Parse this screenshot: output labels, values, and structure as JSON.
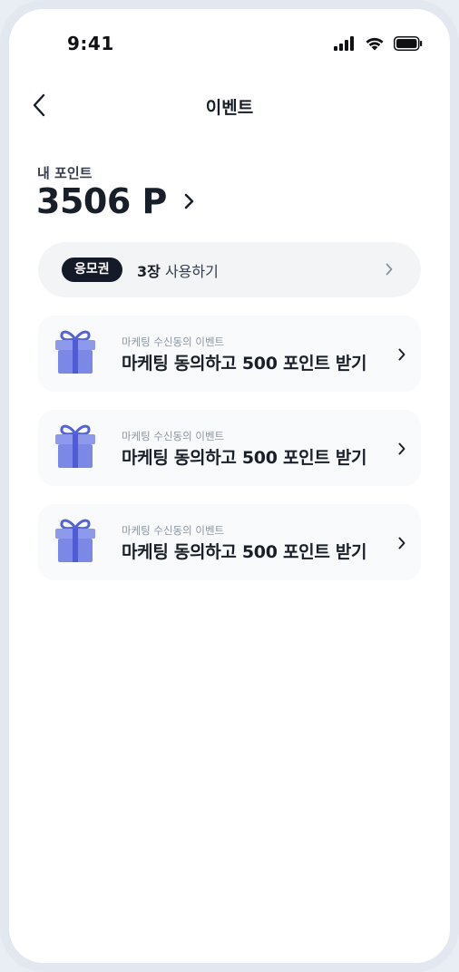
{
  "status_bar": {
    "time": "9:41",
    "icons": [
      "signal-icon",
      "wifi-icon",
      "battery-icon"
    ]
  },
  "header": {
    "back_icon": "chevron-left-icon",
    "title": "이벤트"
  },
  "points": {
    "label": "내 포인트",
    "value": "3506 P"
  },
  "coupon": {
    "badge": "응모권",
    "count": "3장",
    "action": "사용하기"
  },
  "events": [
    {
      "subtitle": "마케팅 수신동의 이벤트",
      "title": "마케팅 동의하고 500 포인트 받기",
      "icon": "gift-icon"
    },
    {
      "subtitle": "마케팅 수신동의 이벤트",
      "title": "마케팅 동의하고 500 포인트 받기",
      "icon": "gift-icon"
    },
    {
      "subtitle": "마케팅 수신동의 이벤트",
      "title": "마케팅 동의하고 500 포인트 받기",
      "icon": "gift-icon"
    }
  ],
  "colors": {
    "accent_gift": "#7b88e6",
    "ribbon": "#4f5cd6",
    "badge_bg": "#151a28",
    "text_primary": "#191f28"
  }
}
